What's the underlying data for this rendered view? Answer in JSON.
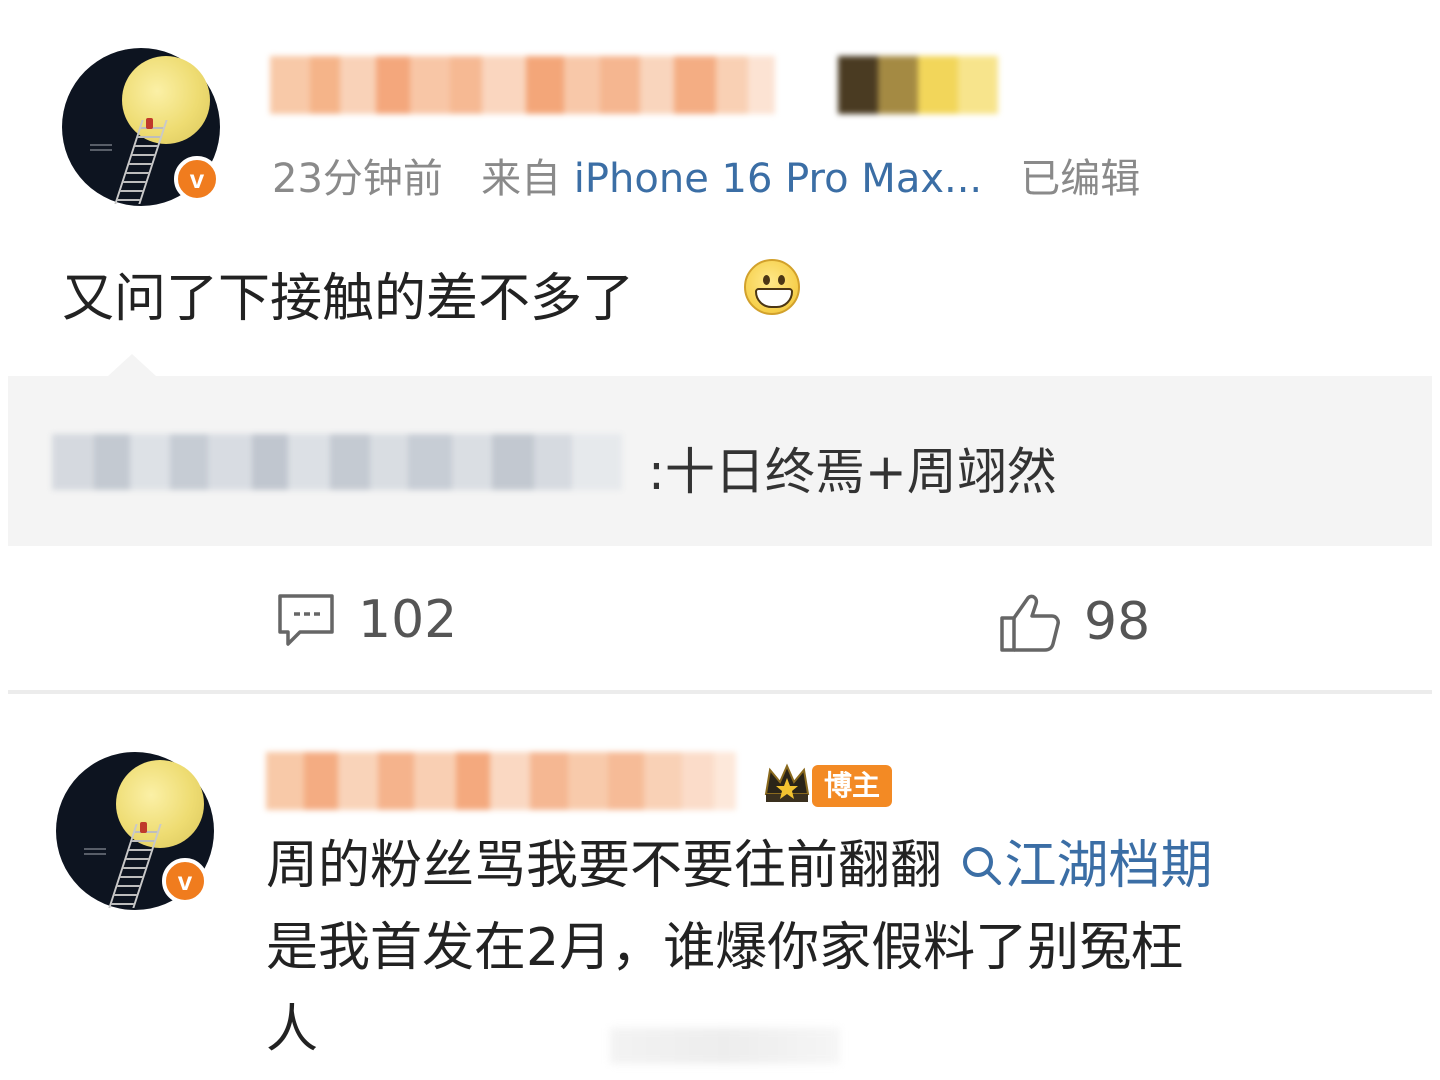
{
  "post": {
    "time": "23分钟前",
    "source_prefix": "来自",
    "source_device": "iPhone 16 Pro Max...",
    "edited": "已编辑",
    "content": "又问了下接触的差不多了",
    "emoji_icon": "grin-emoji-icon",
    "quote": {
      "text": ":十日终焉+周翊然"
    },
    "actions": {
      "comments_count": "102",
      "likes_count": "98"
    }
  },
  "reply": {
    "host_badge": "博主",
    "line1": "周的粉丝骂我要不要往前翻翻",
    "topic": "江湖档期",
    "line2": "是我首发在2月，谁爆你家假料了别冤枉",
    "line3": "人"
  },
  "colors": {
    "verified_badge": "#f07c1e",
    "link": "#3b6ea5",
    "host_badge": "#f38a24",
    "quote_bg": "#f4f4f4"
  }
}
